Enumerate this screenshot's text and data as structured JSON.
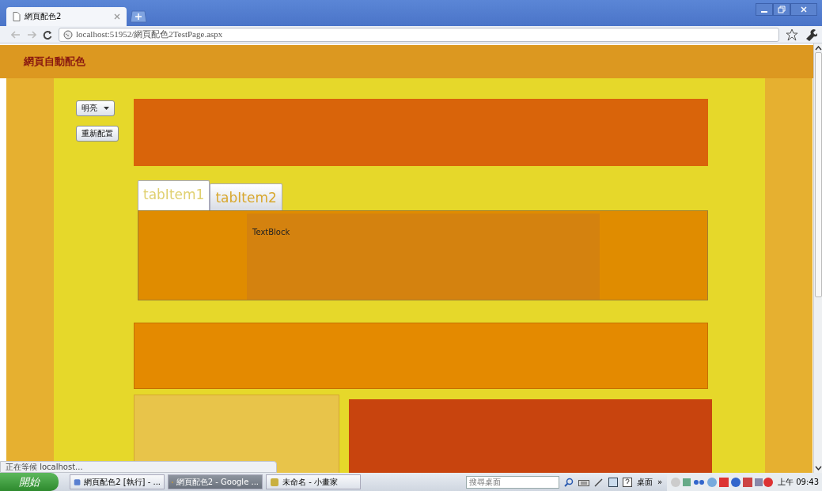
{
  "browser": {
    "tab_title": "網頁配色2",
    "address": "localhost:51952/網頁配色2TestPage.aspx"
  },
  "page": {
    "heading": "網頁自動配色",
    "theme_dropdown": "明亮",
    "regenerate_button": "重新配置",
    "tabs": [
      {
        "label": "tabItem1",
        "selected": true
      },
      {
        "label": "tabItem2",
        "selected": false
      }
    ],
    "tab_content": "TextBlock"
  },
  "status_bar": "正在等候 localhost...",
  "taskbar": {
    "start": "開始",
    "tasks": [
      {
        "label": "網頁配色2 [執行] - ...",
        "selected": false
      },
      {
        "label": "網頁配色2 - Google ...",
        "selected": true
      },
      {
        "label": "未命名 - 小畫家",
        "selected": false
      }
    ],
    "search": {
      "placeholder": "搜尋桌面"
    },
    "desktop": "桌面",
    "more": "»",
    "clock": "上午 09:43"
  }
}
